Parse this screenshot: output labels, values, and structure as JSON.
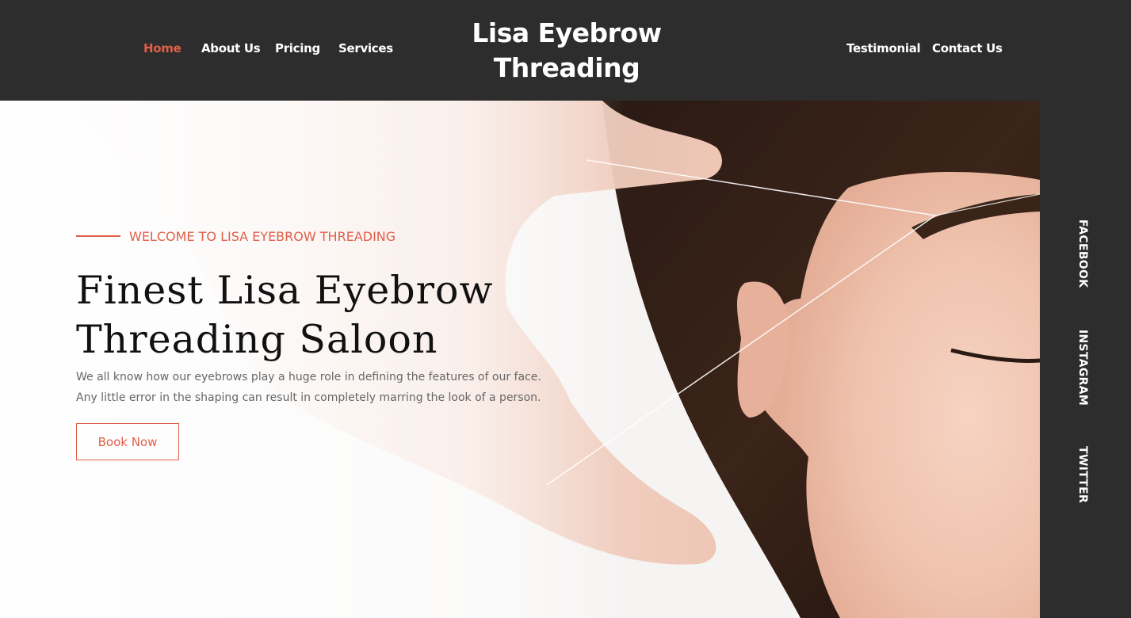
{
  "header": {
    "brand_line1": "Lisa Eyebrow",
    "brand_line2": "Threading",
    "nav_left": [
      "Home",
      "About Us",
      "Pricing",
      "Services"
    ],
    "nav_right": [
      "Testimonial",
      "Contact Us"
    ],
    "active_nav": "Home"
  },
  "hero": {
    "welcome": "WELCOME TO LISA EYEBROW THREADING",
    "headline_line1": "Finest Lisa Eyebrow",
    "headline_line2": "Threading Saloon",
    "intro_line1": "We all know how our eyebrows play a huge role in defining the features of our face.",
    "intro_line2": "Any little error in the shaping can result in completely marring the look of a person.",
    "cta_label": "Book Now"
  },
  "social": [
    "FACEBOOK",
    "INSTAGRAM",
    "TWITTER"
  ],
  "colors": {
    "accent": "#e0604a",
    "header_bg": "#2d2d2d",
    "headline": "#111111",
    "body_text": "#666666"
  }
}
